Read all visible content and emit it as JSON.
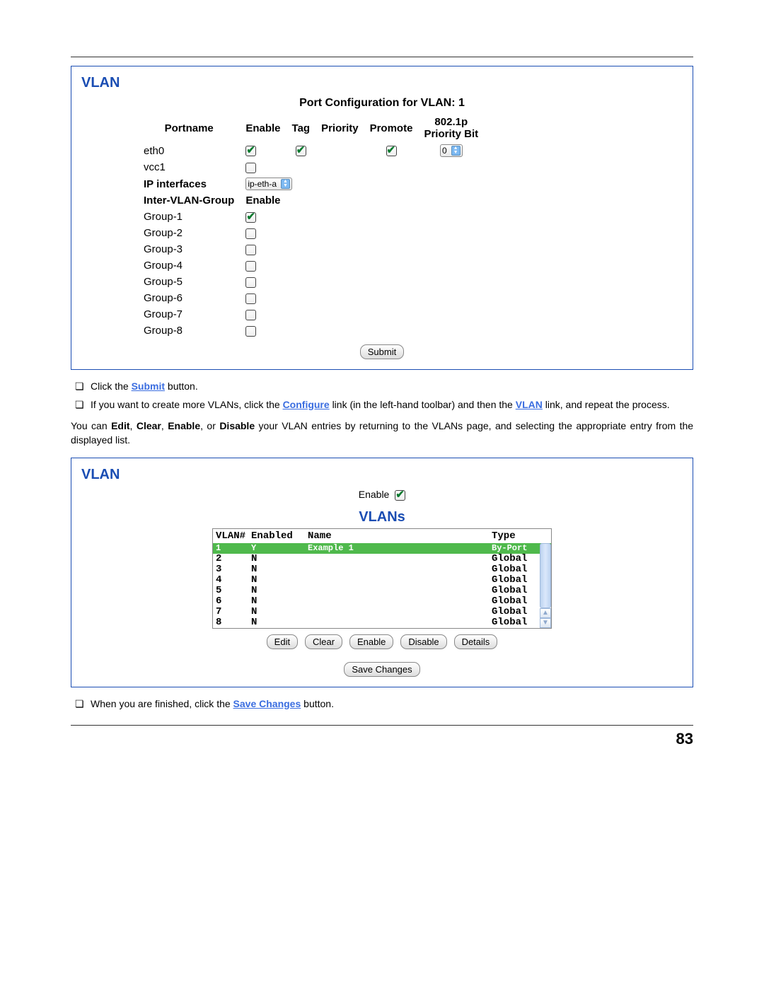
{
  "page_number": "83",
  "panel1": {
    "title": "VLAN",
    "header": "Port Configuration for VLAN: 1",
    "cols": {
      "portname": "Portname",
      "enable": "Enable",
      "tag": "Tag",
      "priority": "Priority",
      "promote": "Promote",
      "pbit1": "802.1p",
      "pbit2": "Priority Bit"
    },
    "rows": {
      "eth0": "eth0",
      "vcc1": "vcc1",
      "ip_if": "IP interfaces",
      "ip_sel": "ip-eth-a",
      "ivg": "Inter-VLAN-Group",
      "ivg_enable": "Enable"
    },
    "groups": [
      "Group-1",
      "Group-2",
      "Group-3",
      "Group-4",
      "Group-5",
      "Group-6",
      "Group-7",
      "Group-8"
    ],
    "pbit_val": "0",
    "submit": "Submit"
  },
  "bul1": {
    "a_pre": "Click the ",
    "a_kw": "Submit",
    "a_post": " button.",
    "b_pre": "If you want to create more VLANs, click the ",
    "b_kw1": "Configure",
    "b_mid": " link (in the left-hand toolbar) and then the ",
    "b_kw2": "VLAN",
    "b_post": " link, and repeat the process."
  },
  "para1": "You can Edit, Clear, Enable, or Disable your VLAN entries by returning to the VLANs page, and selecting the appropriate entry from the displayed list.",
  "para1_parts": {
    "a": "You can ",
    "e": "Edit",
    "c1": ", ",
    "cl": "Clear",
    "c2": ", ",
    "en": "Enable",
    "c3": ", or ",
    "di": "Disable",
    "b": " your VLAN entries by returning to the VLANs page, and selecting the appropriate entry from the displayed list."
  },
  "panel2": {
    "title": "VLAN",
    "enable_label": "Enable",
    "vlans_title": "VLANs",
    "head": {
      "num": "VLAN#",
      "en": "Enabled",
      "name": "Name",
      "type": "Type"
    },
    "rows": [
      {
        "num": "1",
        "en": "Y",
        "name": "Example 1",
        "type": "By-Port",
        "selected": true
      },
      {
        "num": "2",
        "en": "N",
        "name": "",
        "type": "Global"
      },
      {
        "num": "3",
        "en": "N",
        "name": "",
        "type": "Global"
      },
      {
        "num": "4",
        "en": "N",
        "name": "",
        "type": "Global"
      },
      {
        "num": "5",
        "en": "N",
        "name": "",
        "type": "Global"
      },
      {
        "num": "6",
        "en": "N",
        "name": "",
        "type": "Global"
      },
      {
        "num": "7",
        "en": "N",
        "name": "",
        "type": "Global"
      },
      {
        "num": "8",
        "en": "N",
        "name": "",
        "type": "Global"
      }
    ],
    "btns": {
      "edit": "Edit",
      "clear": "Clear",
      "enable": "Enable",
      "disable": "Disable",
      "details": "Details",
      "save": "Save Changes"
    }
  },
  "bul2": {
    "pre": "When you are finished, click the ",
    "kw": "Save Changes",
    "post": " button."
  }
}
